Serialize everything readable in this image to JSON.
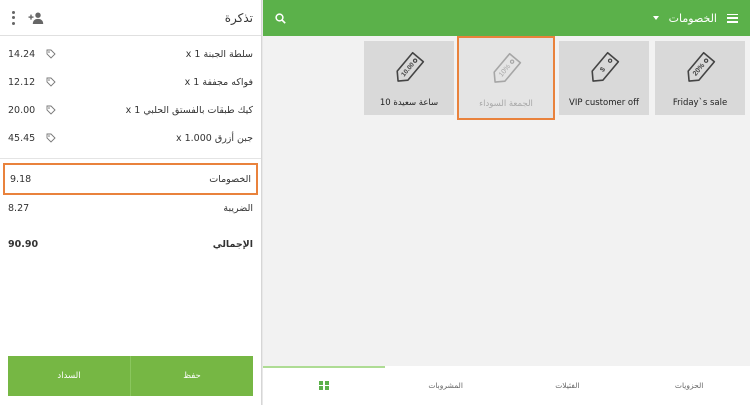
{
  "ticket": {
    "title": "تذكرة",
    "items": [
      {
        "name": "سلطة الجبنة x 1",
        "amount": "14.24"
      },
      {
        "name": "فواكه مجففة x 1",
        "amount": "12.12"
      },
      {
        "name": "كيك طبقات بالفستق الحلبي x 1",
        "amount": "20.00"
      },
      {
        "name": "جبن أزرق x 1.000",
        "amount": "45.45"
      }
    ],
    "discount": {
      "label": "الخصومات",
      "value": "9.18"
    },
    "tax": {
      "label": "الضريبة",
      "value": "8.27"
    },
    "total": {
      "label": "الإجمالي",
      "value": "90.90"
    },
    "buttons": {
      "pay": "السداد",
      "save": "حفظ"
    }
  },
  "topbar": {
    "title": "الخصومات"
  },
  "discounts": [
    {
      "label": "Friday`s sale",
      "badge": "20%"
    },
    {
      "label": "VIP customer off",
      "badge": "$"
    },
    {
      "label": "الجمعة السوداء",
      "badge": "10%"
    },
    {
      "label": "ساعة سعيدة 10",
      "badge": "10.00"
    }
  ],
  "bottom_nav": {
    "items": [
      "الحزويات",
      "الفئيلات",
      "المشروبات"
    ]
  },
  "colors": {
    "accent": "#5bb14a",
    "button": "#76b744",
    "highlight": "#e9823c"
  }
}
